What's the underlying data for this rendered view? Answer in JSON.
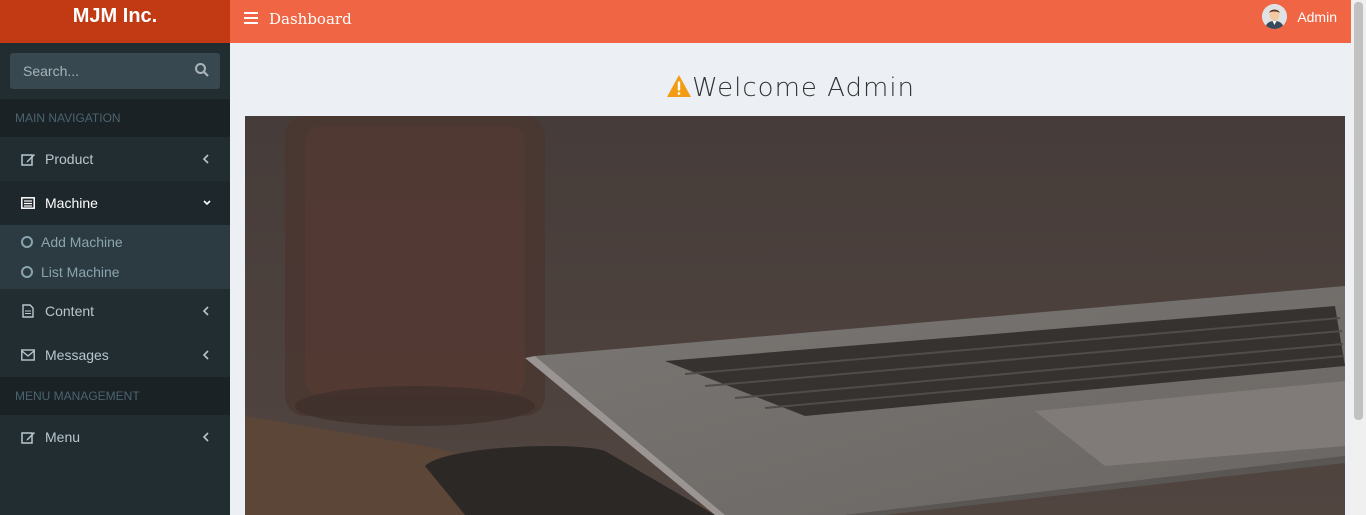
{
  "brand": {
    "name": "MJM Inc."
  },
  "search": {
    "placeholder": "Search..."
  },
  "sidebar": {
    "sections": [
      {
        "label": "MAIN NAVIGATION"
      },
      {
        "label": "MENU MANAGEMENT"
      }
    ],
    "items": [
      {
        "label": "Product",
        "icon": "edit-icon"
      },
      {
        "label": "Machine",
        "icon": "list-icon"
      },
      {
        "label": "Content",
        "icon": "file-icon"
      },
      {
        "label": "Messages",
        "icon": "envelope-icon"
      },
      {
        "label": "Menu",
        "icon": "edit-icon"
      }
    ],
    "machine_sub": [
      {
        "label": "Add Machine"
      },
      {
        "label": "List Machine"
      }
    ]
  },
  "header": {
    "title": "Dashboard",
    "user": "Admin"
  },
  "main": {
    "welcome": "Welcome Admin"
  },
  "colors": {
    "topbar": "#f06543",
    "logo": "#c23a14",
    "sidebar": "#222d32",
    "warning": "#f39c12"
  }
}
